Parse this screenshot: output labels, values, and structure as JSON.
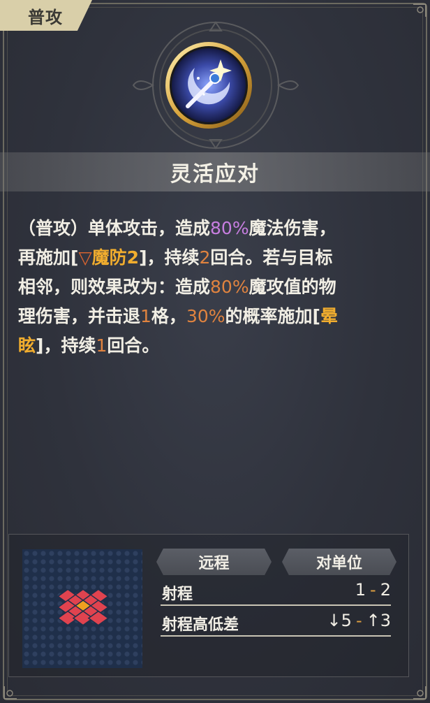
{
  "tag": {
    "label": "普攻"
  },
  "skill": {
    "name": "灵活应对",
    "icon": "magic-staff-icon"
  },
  "description": {
    "line1_a": "（普攻）单体攻击，造成",
    "line1_pct": "80%",
    "line1_b": "魔法伤害，",
    "line2_a": "再施加[",
    "line2_status": "魔防2",
    "line2_b": "]，持续",
    "line2_num": "2",
    "line2_c": "回合。若与目标",
    "line3_a": "相邻，则效果改为：造成",
    "line3_pct": "80%",
    "line3_b": "魔攻值的物",
    "line4_a": "理伤害，并击退",
    "line4_num": "1",
    "line4_b": "格，",
    "line4_pct": "30%",
    "line4_c": "的概率施加[",
    "line4_status": "晕",
    "line5_status": "眩",
    "line5_a": "]，持续",
    "line5_num": "1",
    "line5_b": "回合。"
  },
  "attack_info": {
    "type_label": "远程",
    "target_label": "对单位",
    "range_label": "射程",
    "range_min": "1",
    "range_max": "2",
    "height_label": "射程高低差",
    "height_down": "↓5",
    "height_up": "↑3",
    "separator": "-"
  },
  "colors": {
    "highlight_purple": "#c77ee0",
    "highlight_orange": "#e0833f",
    "status_gold": "#f1ad2e",
    "range_cell": "#e0434f",
    "range_center": "#f0a020"
  }
}
